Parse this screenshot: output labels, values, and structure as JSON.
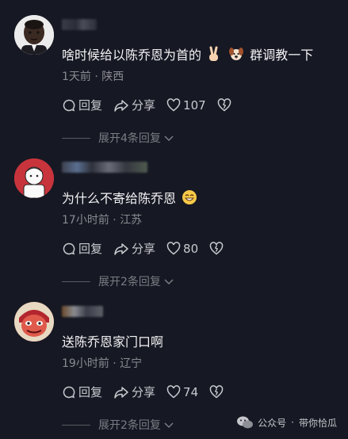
{
  "comments": [
    {
      "text": "啥时候给以陈乔恩为首的",
      "text_tail": "群调教一下",
      "time": "1天前",
      "location": "陕西",
      "reply_label": "回复",
      "share_label": "分享",
      "likes": "107",
      "likes_shown": true,
      "expand_label": "展开4条回复"
    },
    {
      "text": "为什么不寄给陈乔恩",
      "text_tail": "",
      "time": "17小时前",
      "location": "江苏",
      "reply_label": "回复",
      "share_label": "分享",
      "likes": "80",
      "likes_shown": true,
      "expand_label": "展开2条回复"
    },
    {
      "text": "送陈乔恩家门口啊",
      "text_tail": "",
      "time": "19小时前",
      "location": "辽宁",
      "reply_label": "回复",
      "share_label": "分享",
      "likes": "74",
      "likes_shown": true,
      "expand_label": "展开2条回复"
    }
  ],
  "separator": "·",
  "watermark": {
    "platform": "公众号",
    "account": "带你恰瓜"
  },
  "colors": {
    "background": "#161823",
    "text": "#f2f2f4",
    "meta": "#8a8b91"
  }
}
